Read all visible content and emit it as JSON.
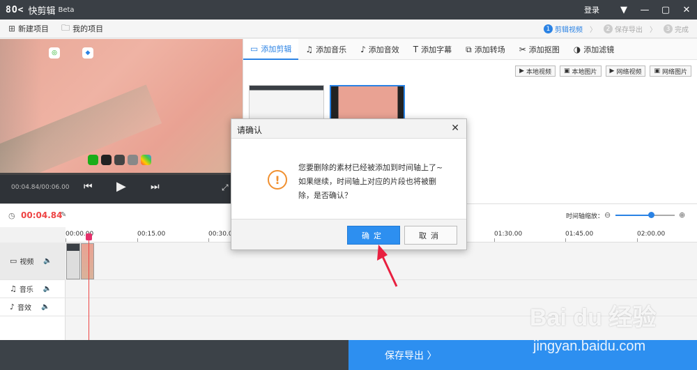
{
  "app": {
    "logo": "8O<",
    "name": "快剪辑",
    "badge": "Beta",
    "login": "登录"
  },
  "menu": {
    "new_project": "新建项目",
    "my_projects": "我的项目"
  },
  "steps": [
    {
      "num": "1",
      "label": "剪辑视频"
    },
    {
      "num": "2",
      "label": "保存导出"
    },
    {
      "num": "3",
      "label": "完成"
    }
  ],
  "player": {
    "time": "00:04.84/00:06.00"
  },
  "tabs": [
    {
      "label": "添加剪辑",
      "icon": "video-icon"
    },
    {
      "label": "添加音乐",
      "icon": "music-icon"
    },
    {
      "label": "添加音效",
      "icon": "sound-effect-icon"
    },
    {
      "label": "添加字幕",
      "icon": "text-icon"
    },
    {
      "label": "添加转场",
      "icon": "transition-icon"
    },
    {
      "label": "添加抠图",
      "icon": "cutout-icon"
    },
    {
      "label": "添加滤镜",
      "icon": "filter-icon"
    }
  ],
  "sources": [
    "本地视频",
    "本地图片",
    "网络视频",
    "网络图片"
  ],
  "timeline": {
    "current": "00:04.84",
    "zoom_label": "时间轴缩放：",
    "zoom_level": 0.6,
    "ticks": [
      "00:00.00",
      "00:15.00",
      "00:30.00",
      "01:30.00",
      "01:45.00",
      "02:00.00"
    ],
    "tracks": [
      "视频",
      "音乐",
      "音效"
    ]
  },
  "export": {
    "label": "保存导出 〉"
  },
  "dialog": {
    "title": "请确认",
    "message": "您要删除的素材已经被添加到时间轴上了~如果继续，时间轴上对应的片段也将被删除，是否确认？",
    "ok": "确定",
    "cancel": "取消"
  },
  "watermark": {
    "brand": "Bai du 经验",
    "url": "jingyan.baidu.com"
  },
  "colors": {
    "accent": "#2d8ff0",
    "warning": "#f09030",
    "playhead": "#e4306b",
    "arrow": "#e82040"
  }
}
